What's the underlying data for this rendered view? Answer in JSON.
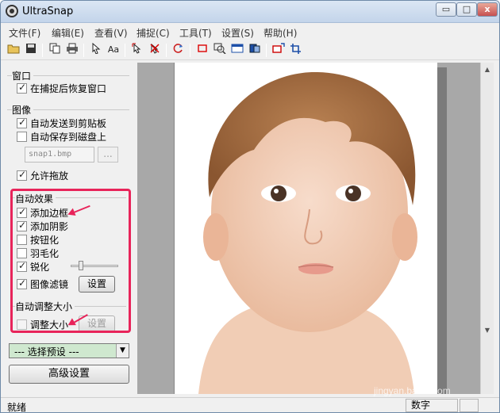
{
  "window": {
    "title": "UltraSnap",
    "controls": {
      "minimize": "▭",
      "maximize": "□",
      "close": "x"
    }
  },
  "menu": [
    "文件(F)",
    "编辑(E)",
    "查看(V)",
    "捕捉(C)",
    "工具(T)",
    "设置(S)",
    "帮助(H)"
  ],
  "toolbar": {
    "font_label": "Aa"
  },
  "panel": {
    "window_group": {
      "title": "窗口",
      "restore_after_capture": {
        "label": "在捕捉后恢复窗口",
        "checked": true
      }
    },
    "image_group": {
      "title": "图像",
      "auto_send_clipboard": {
        "label": "自动发送到剪贴板",
        "checked": true
      },
      "auto_save_disk": {
        "label": "自动保存到磁盘上",
        "checked": false
      },
      "filename": "snap1.bmp",
      "browse_label": "...",
      "allow_drag": {
        "label": "允许拖放",
        "checked": true
      }
    },
    "auto_effects": {
      "title": "自动效果",
      "add_border": {
        "label": "添加边框",
        "checked": true
      },
      "add_shadow": {
        "label": "添加阴影",
        "checked": true
      },
      "buttonize": {
        "label": "按钮化",
        "checked": false
      },
      "feather": {
        "label": "羽毛化",
        "checked": false
      },
      "sharpen": {
        "label": "锐化",
        "checked": true,
        "level": 0.2
      },
      "image_filter": {
        "label": "图像滤镜",
        "checked": true
      },
      "settings_label": "设置"
    },
    "auto_resize": {
      "title": "自动调整大小",
      "resize": {
        "label": "调整大小",
        "checked": false
      },
      "settings_label": "设置"
    },
    "preset": {
      "selected": "---  选择预设  ---"
    },
    "advanced_label": "高级设置"
  },
  "status": {
    "text": "就绪",
    "num": "数字"
  },
  "watermark": "jingyan.baidu.com",
  "colors": {
    "highlight": "#e8245a",
    "preset_bg": "#cfe8cf"
  }
}
